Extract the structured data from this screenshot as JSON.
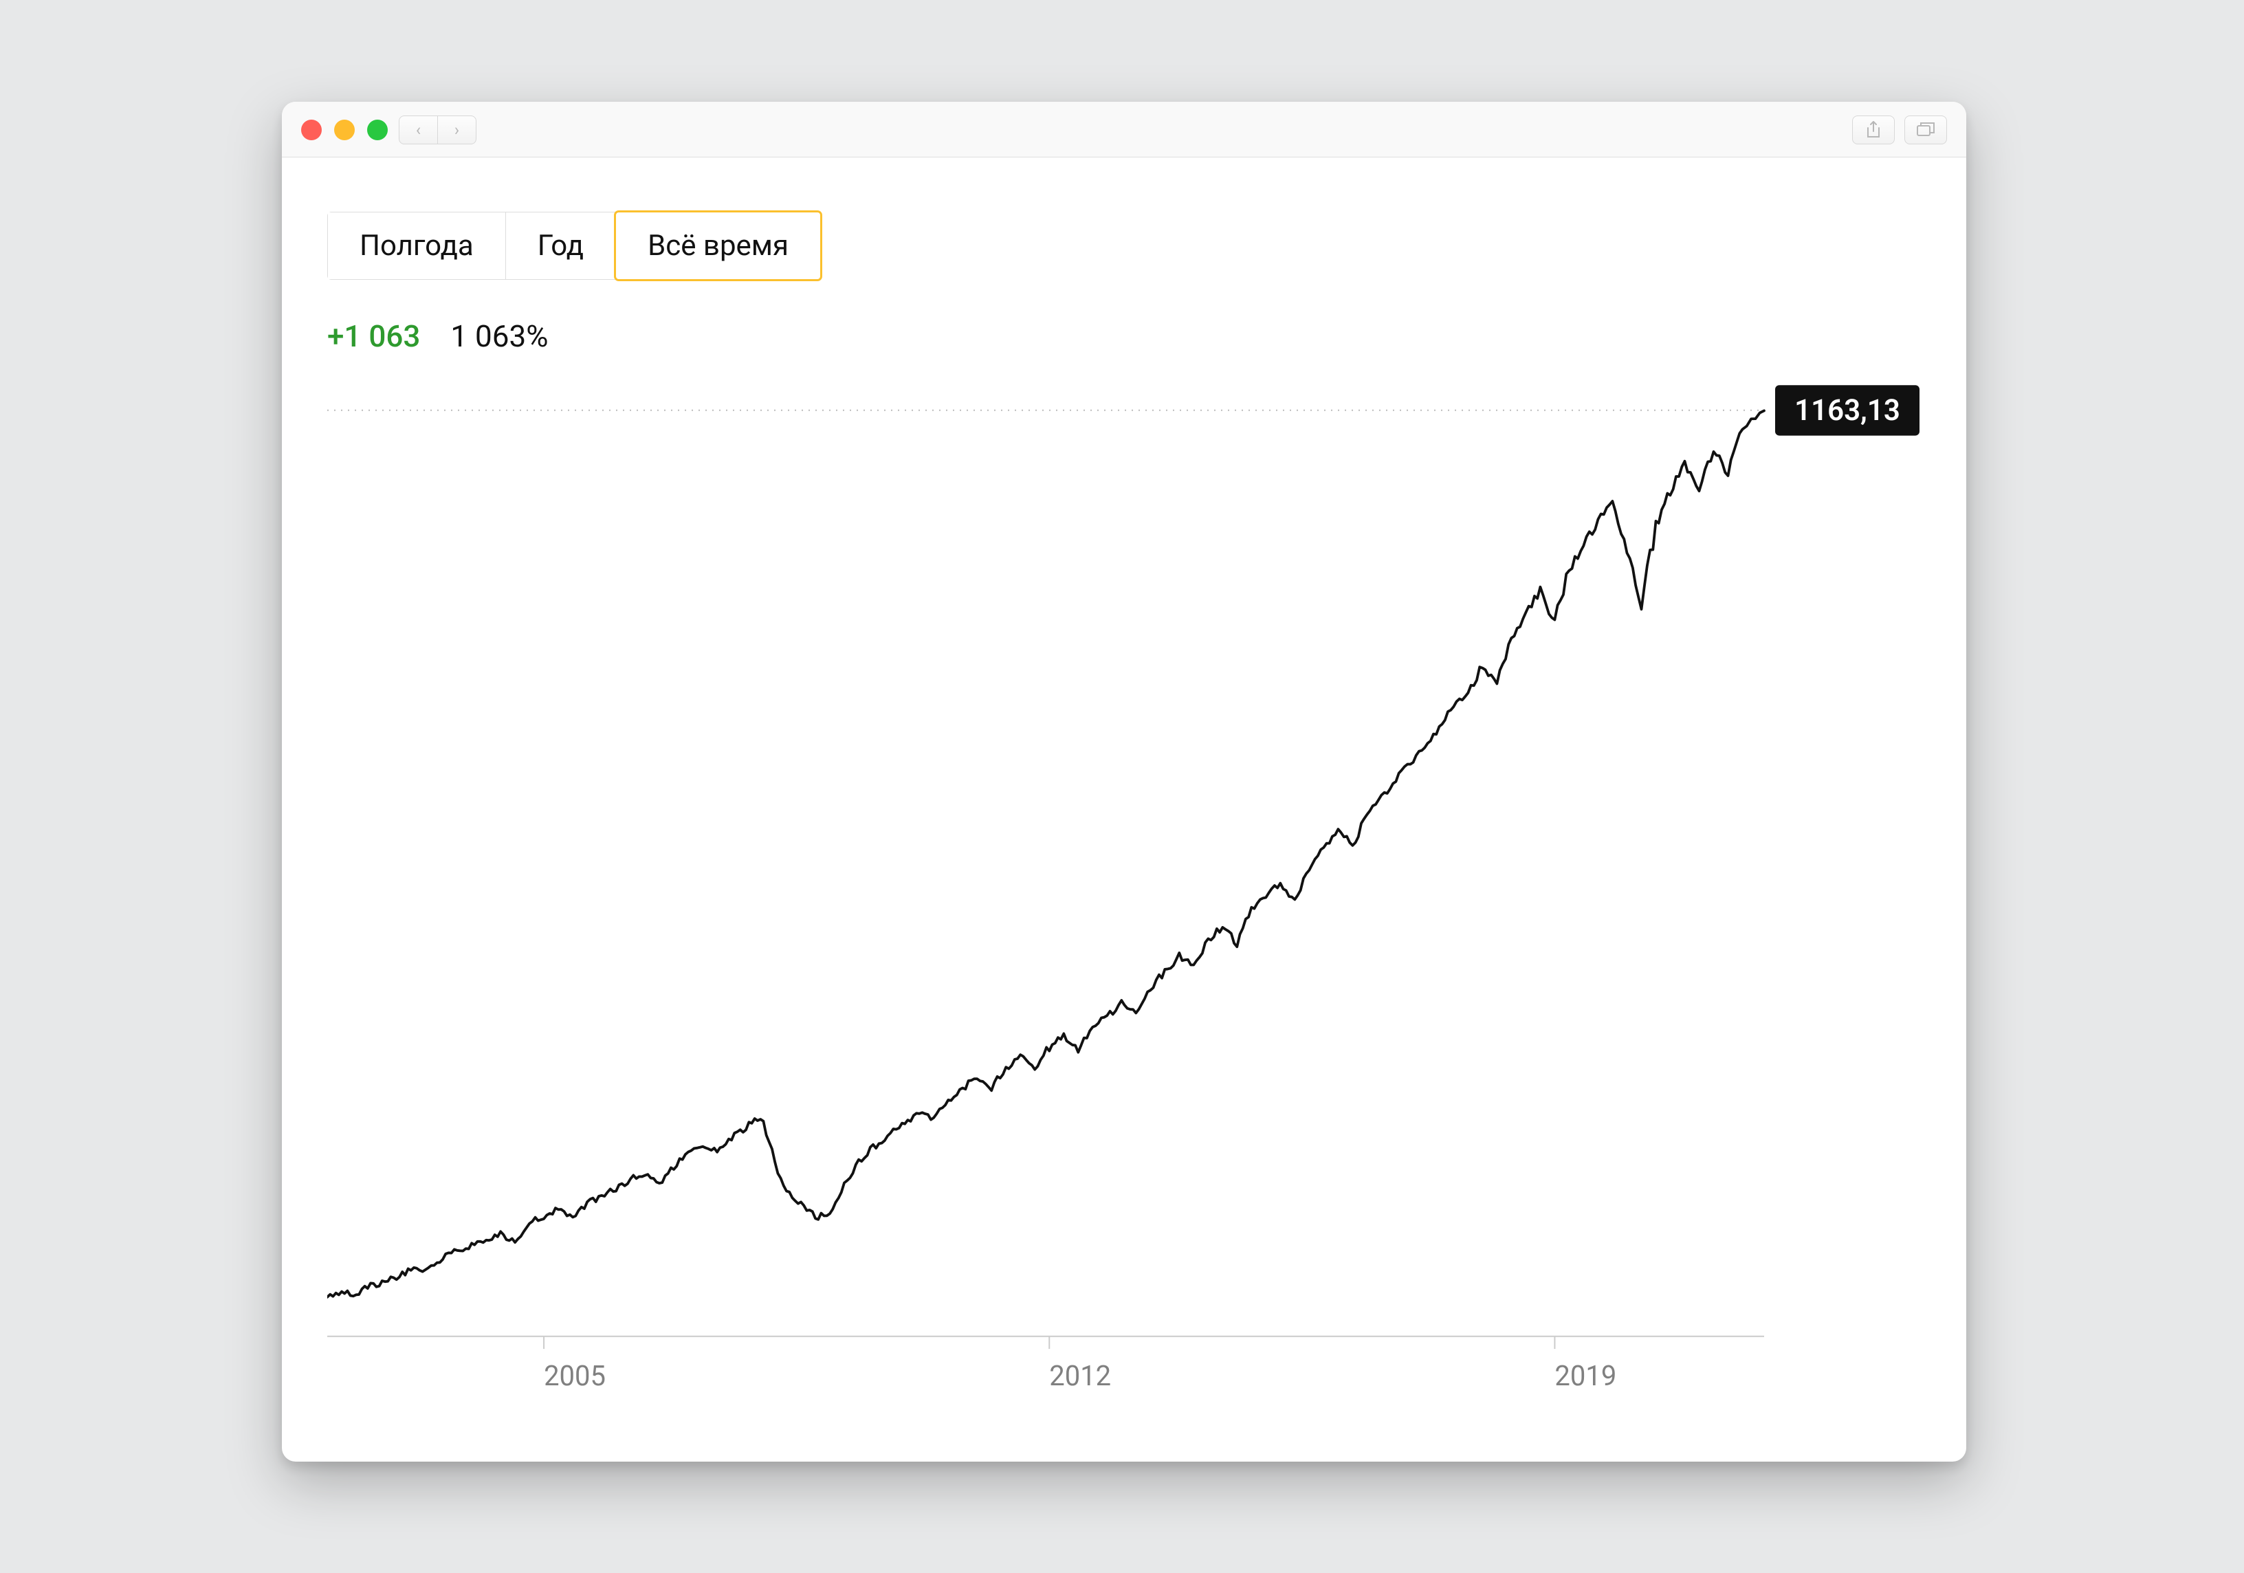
{
  "window": {
    "traffic": {
      "close": "#ff5f57",
      "minimize": "#febc2e",
      "zoom": "#28c840"
    }
  },
  "range_tabs": {
    "items": [
      {
        "label": "Полгода",
        "active": false
      },
      {
        "label": "Год",
        "active": false
      },
      {
        "label": "Всё время",
        "active": true
      }
    ]
  },
  "stats": {
    "abs_change": "+1 063",
    "pct_change": "1 063%",
    "change_color": "#2e9a2e"
  },
  "tooltip": {
    "value": "1163,13"
  },
  "chart_data": {
    "type": "line",
    "xlabel": "",
    "ylabel": "",
    "x_ticks": [
      2005,
      2012,
      2019
    ],
    "ylim": [
      100,
      1163.13
    ],
    "reference_line": 1163.13,
    "series": [
      {
        "name": "value",
        "x": [
          2002.0,
          2002.2,
          2002.4,
          2002.6,
          2002.8,
          2003.0,
          2003.2,
          2003.4,
          2003.6,
          2003.8,
          2004.0,
          2004.2,
          2004.4,
          2004.6,
          2004.8,
          2005.0,
          2005.2,
          2005.4,
          2005.6,
          2005.8,
          2006.0,
          2006.2,
          2006.4,
          2006.6,
          2006.8,
          2007.0,
          2007.2,
          2007.4,
          2007.6,
          2007.8,
          2008.0,
          2008.2,
          2008.4,
          2008.6,
          2008.8,
          2009.0,
          2009.2,
          2009.4,
          2009.6,
          2009.8,
          2010.0,
          2010.2,
          2010.4,
          2010.6,
          2010.8,
          2011.0,
          2011.2,
          2011.4,
          2011.6,
          2011.8,
          2012.0,
          2012.2,
          2012.4,
          2012.6,
          2012.8,
          2013.0,
          2013.2,
          2013.4,
          2013.6,
          2013.8,
          2014.0,
          2014.2,
          2014.4,
          2014.6,
          2014.8,
          2015.0,
          2015.2,
          2015.4,
          2015.6,
          2015.8,
          2016.0,
          2016.2,
          2016.4,
          2016.6,
          2016.8,
          2017.0,
          2017.2,
          2017.4,
          2017.6,
          2017.8,
          2018.0,
          2018.2,
          2018.4,
          2018.6,
          2018.8,
          2019.0,
          2019.2,
          2019.4,
          2019.6,
          2019.8,
          2020.0,
          2020.2,
          2020.4,
          2020.6,
          2020.8,
          2021.0,
          2021.2,
          2021.4,
          2021.6,
          2021.9
        ],
        "values": [
          145,
          152,
          148,
          158,
          162,
          170,
          178,
          176,
          190,
          198,
          205,
          212,
          218,
          208,
          230,
          238,
          246,
          236,
          252,
          262,
          270,
          280,
          288,
          275,
          296,
          308,
          320,
          312,
          328,
          340,
          352,
          298,
          260,
          248,
          236,
          245,
          280,
          305,
          320,
          332,
          345,
          358,
          348,
          370,
          384,
          398,
          386,
          408,
          420,
          410,
          432,
          444,
          430,
          455,
          468,
          482,
          473,
          500,
          518,
          536,
          528,
          556,
          570,
          550,
          590,
          606,
          622,
          598,
          640,
          660,
          680,
          665,
          700,
          718,
          740,
          758,
          778,
          800,
          822,
          840,
          870,
          850,
          900,
          928,
          956,
          920,
          980,
          1008,
          1036,
          1062,
          1000,
          940,
          1030,
          1070,
          1100,
          1075,
          1118,
          1090,
          1140,
          1163
        ]
      }
    ]
  }
}
